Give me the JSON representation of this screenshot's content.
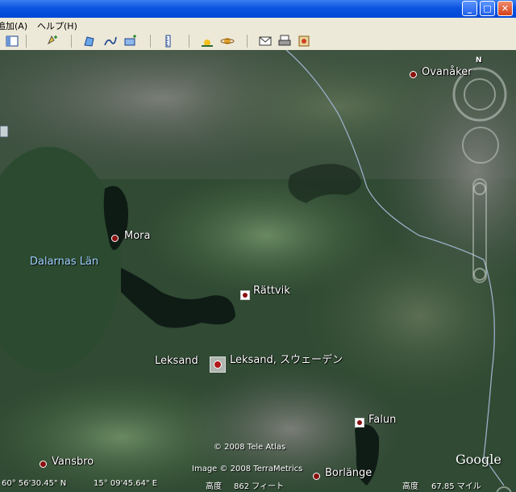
{
  "menubar": {
    "items": [
      {
        "label": "追加(A)"
      },
      {
        "label": "ヘルプ(H)"
      }
    ]
  },
  "toolbar": {
    "buttons": [
      {
        "icon": "sidebar-toggle-icon"
      },
      {
        "icon": "placemark-add-icon"
      },
      {
        "icon": "polygon-add-icon"
      },
      {
        "icon": "path-add-icon"
      },
      {
        "icon": "overlay-add-icon"
      },
      {
        "icon": "ruler-icon"
      },
      {
        "icon": "sunlight-icon"
      },
      {
        "icon": "planets-icon"
      },
      {
        "icon": "email-icon"
      },
      {
        "icon": "print-icon"
      },
      {
        "icon": "save-image-icon"
      }
    ]
  },
  "map": {
    "places": [
      {
        "name": "Ovanåker"
      },
      {
        "name": "Mora"
      },
      {
        "name": "Rättvik"
      },
      {
        "name": "Leksand"
      },
      {
        "name": "Leksand, スウェーデン"
      },
      {
        "name": "Falun"
      },
      {
        "name": "Vansbro"
      },
      {
        "name": "Borlänge"
      }
    ],
    "region": "Dalarnas Län",
    "compass_north": "N",
    "copyright_1": "© 2008 Tele Atlas",
    "copyright_2": "Image © 2008 TerraMetrics",
    "logo": "Google"
  },
  "status": {
    "lat": "60° 56'30.45\" N",
    "lon": "15° 09'45.64\" E",
    "elev_label": "高度",
    "elev_value": "862 フィート",
    "eye_label": "高度",
    "eye_value": "67.85 マイル"
  }
}
